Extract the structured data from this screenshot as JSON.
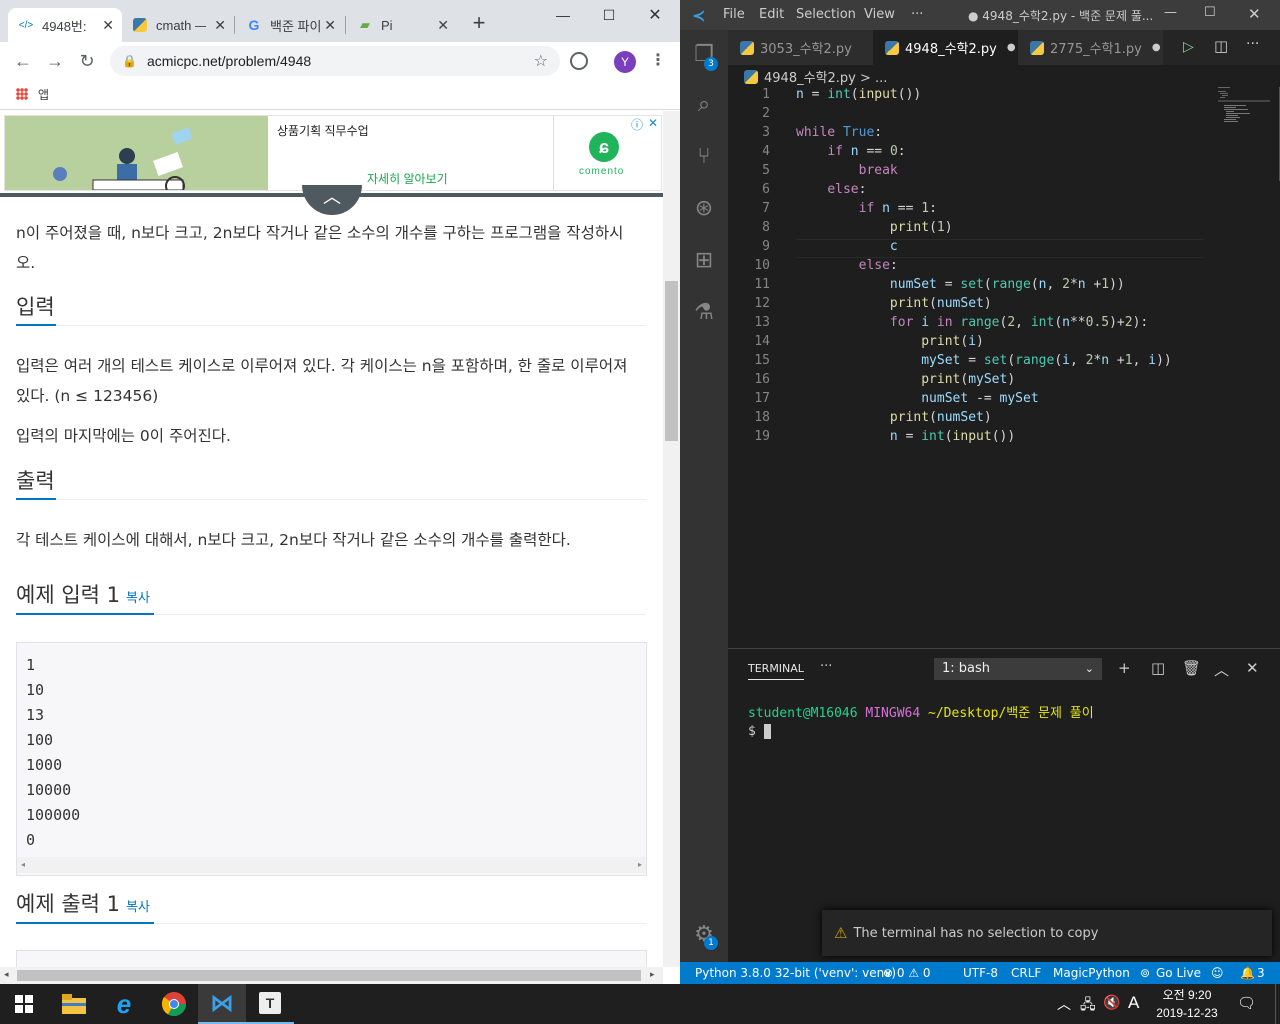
{
  "browser": {
    "tabs": [
      {
        "label": "4948번: ",
        "icon": "acm-icon"
      },
      {
        "label": "cmath — ",
        "icon": "python-icon"
      },
      {
        "label": "백준 파이",
        "icon": "google-icon"
      },
      {
        "label": "Pi",
        "icon": "page-icon"
      }
    ],
    "url": "acmicpc.net/problem/4948",
    "profile_initial": "Y",
    "bookmarks_label": "앱",
    "ad": {
      "headline": "상품기획 직무수업",
      "cta": "자세히 알아보기",
      "brand": "comento"
    },
    "problem": {
      "description": "n이 주어졌을 때, n보다 크고, 2n보다 작거나 같은 소수의 개수를 구하는 프로그램을 작성하시\n오.",
      "input_heading": "입력",
      "input_text_1": "입력은 여러 개의 테스트 케이스로 이루어져 있다. 각 케이스는 n을 포함하며, 한 줄로 이루어져",
      "input_text_2": "있다. (n ≤ 123456)",
      "input_text_3": "입력의 마지막에는 0이 주어진다.",
      "output_heading": "출력",
      "output_text": "각 테스트 케이스에 대해서, n보다 크고, 2n보다 작거나 같은 소수의 개수를 출력한다.",
      "sample_input_heading": "예제 입력 1",
      "sample_output_heading": "예제 출력 1",
      "copy_label": "복사",
      "sample_input": "1\n10\n13\n100\n1000\n10000\n100000\n0"
    }
  },
  "vscode": {
    "menu": [
      "File",
      "Edit",
      "Selection",
      "View",
      "···"
    ],
    "window_title": "● 4948_수학2.py - 백준 문제 풀...",
    "tabs": [
      {
        "label": "3053_수학2.py",
        "dirty": ""
      },
      {
        "label": "4948_수학2.py",
        "dirty": "●"
      },
      {
        "label": "2775_수학1.py",
        "dirty": "●"
      }
    ],
    "breadcrumb": "4948_수학2.py > ...",
    "explorer_badge": "3",
    "settings_badge": "1",
    "line_numbers": [
      "1",
      "2",
      "3",
      "4",
      "5",
      "6",
      "7",
      "8",
      "9",
      "10",
      "11",
      "12",
      "13",
      "14",
      "15",
      "16",
      "17",
      "18",
      "19"
    ],
    "terminal": {
      "tab_label": "TERMINAL",
      "more": "···",
      "shell": "1: bash",
      "prompt_user": "student@M16046",
      "prompt_env": "MINGW64",
      "prompt_path": "~/Desktop/백준 문제 풀이",
      "prompt_symbol": "$"
    },
    "notification": "The terminal has no selection to copy",
    "status": {
      "python": "Python 3.8.0 32-bit ('venv': venv)",
      "problems": "⊗ 0 ⚠ 0",
      "encoding": "UTF-8",
      "eol": "CRLF",
      "language": "MagicPython",
      "golive": "Go Live",
      "bell_count": "3"
    }
  },
  "taskbar": {
    "time": "오전 9:20",
    "date": "2019-12-23",
    "ime": "A"
  }
}
